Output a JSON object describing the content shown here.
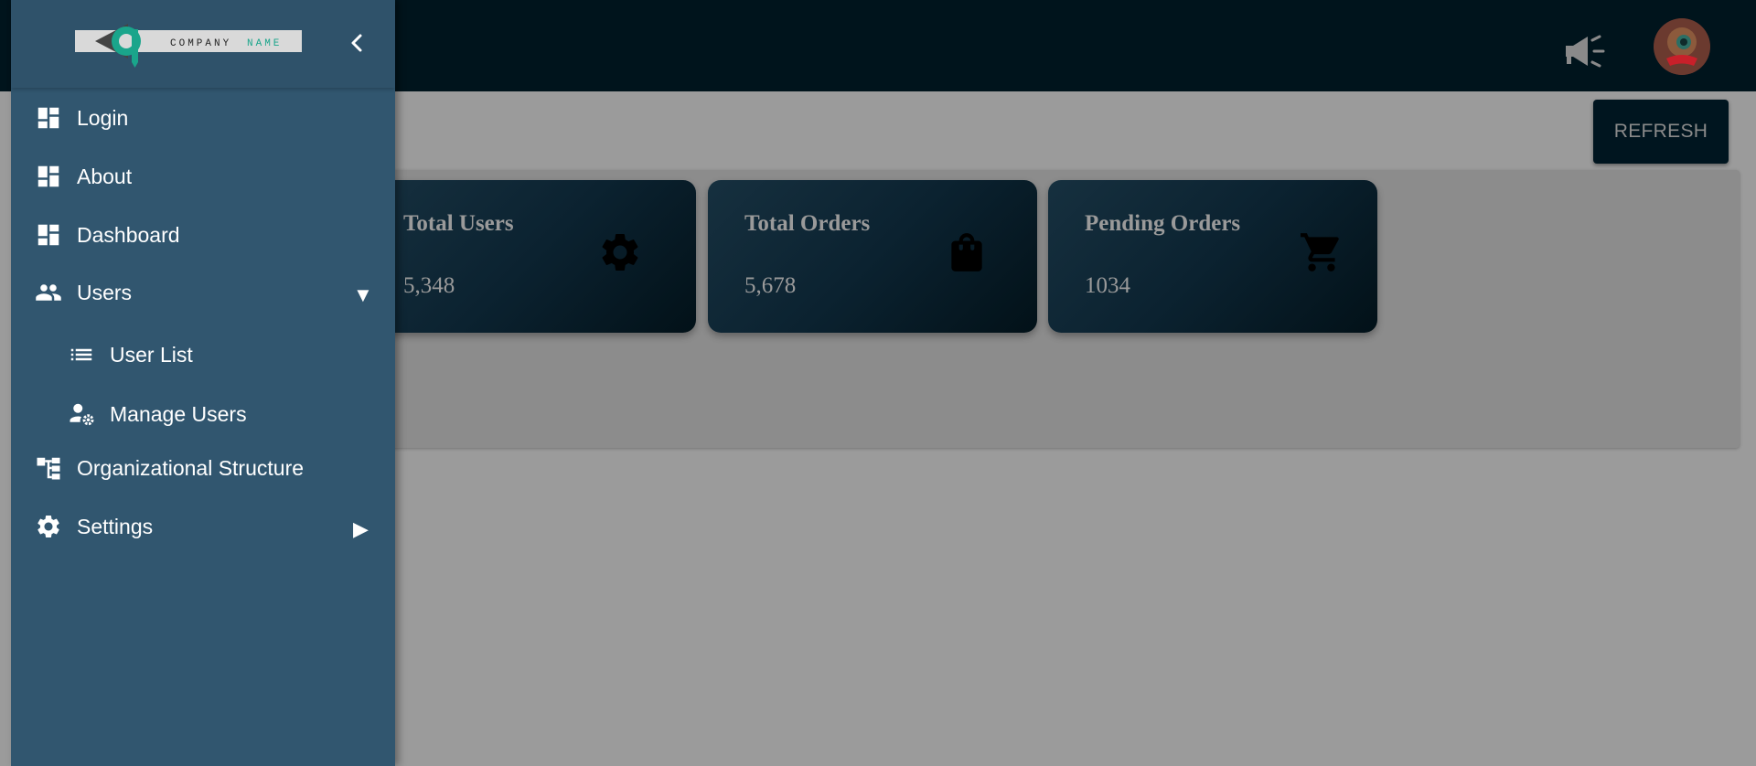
{
  "header": {
    "announcement_icon": "megaphone-icon",
    "avatar_icon": "user-avatar"
  },
  "toolbar": {
    "refresh_label": "REFRESH"
  },
  "cards": [
    {
      "title": "Total Users",
      "value": "5,348",
      "icon": "gear-icon"
    },
    {
      "title": "Total Orders",
      "value": "5,678",
      "icon": "shopping-bag-icon"
    },
    {
      "title": "Pending Orders",
      "value": "1034",
      "icon": "shopping-cart-icon"
    }
  ],
  "sidebar": {
    "logo": {
      "text_company": "COMPANY",
      "text_name": "NAME"
    },
    "items": [
      {
        "label": "Login",
        "icon": "dashboard-icon"
      },
      {
        "label": "About",
        "icon": "dashboard-icon"
      },
      {
        "label": "Dashboard",
        "icon": "dashboard-icon"
      },
      {
        "label": "Users",
        "icon": "group-icon",
        "expanded": true,
        "arrow": "▼"
      },
      {
        "label": "User List",
        "icon": "list-icon"
      },
      {
        "label": "Manage Users",
        "icon": "manage-user-icon"
      },
      {
        "label": "Organizational Structure",
        "icon": "org-structure-icon"
      },
      {
        "label": "Settings",
        "icon": "gear-icon",
        "expanded": false,
        "arrow": "▶"
      }
    ]
  },
  "colors": {
    "sidebar": "#31566f",
    "topbar": "#00141c",
    "card_gradient_start": "#16303f",
    "card_gradient_end": "#021118",
    "logo_accent": "#1aa58b"
  }
}
